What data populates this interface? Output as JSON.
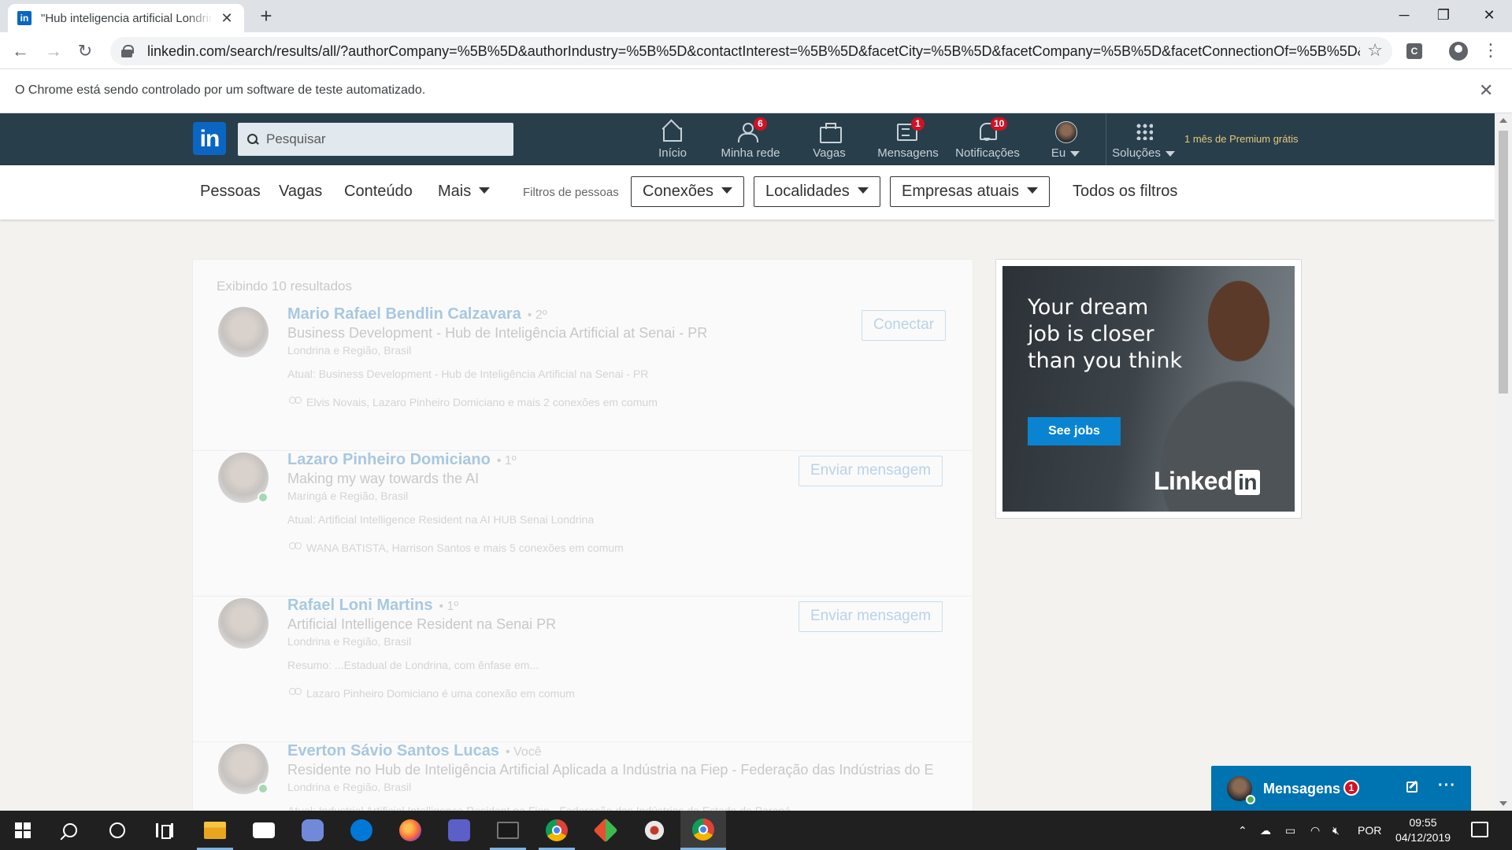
{
  "browser": {
    "tab_title": "\"Hub inteligencia artificial Londrina\"",
    "tab_favicon": "in",
    "url": "linkedin.com/search/results/all/?authorCompany=%5B%5D&authorIndustry=%5B%5D&contactInterest=%5B%5D&facetCity=%5B%5D&facetCompany=%5B%5D&facetConnectionOf=%5B%5D&fac...",
    "infobar_text": "O Chrome está sendo controlado por um software de teste automatizado.",
    "extension_label": "C"
  },
  "linkedin": {
    "logo": "in",
    "search_placeholder": "Pesquisar",
    "nav": {
      "home": "Início",
      "network": "Minha rede",
      "network_badge": "6",
      "jobs": "Vagas",
      "messages": "Mensagens",
      "messages_badge": "1",
      "notifications": "Notificações",
      "notifications_badge": "10",
      "me": "Eu",
      "solutions": "Soluções",
      "premium": "1 mês de Premium grátis"
    },
    "filters": {
      "tabs": [
        "Pessoas",
        "Vagas",
        "Conteúdo",
        "Mais"
      ],
      "people_filters_label": "Filtros de pessoas",
      "connections": "Conexões",
      "locations": "Localidades",
      "companies": "Empresas atuais",
      "all_filters": "Todos os filtros"
    },
    "results": {
      "count_text": "Exibindo 10 resultados",
      "items": [
        {
          "name": "Mario Rafael Bendlin Calzavara",
          "degree": "• 2º",
          "headline": "Business Development - Hub de Inteligência Artificial at Senai - PR",
          "location": "Londrina e Região, Brasil",
          "snippet": "Atual: Business Development - Hub de Inteligência Artificial na Senai - PR",
          "shared": "Elvis Novais, Lazaro Pinheiro Domiciano e mais 2 conexões em comum",
          "action": "Conectar"
        },
        {
          "name": "Lazaro Pinheiro Domiciano",
          "degree": "• 1º",
          "headline": "Making my way towards the AI",
          "location": "Maringá e Região, Brasil",
          "snippet": "Atual: Artificial Intelligence Resident na AI HUB Senai Londrina",
          "shared": "WANA BATISTA, Harrison Santos e mais 5 conexões em comum",
          "action": "Enviar mensagem"
        },
        {
          "name": "Rafael Loni Martins",
          "degree": "• 1º",
          "headline": "Artificial Intelligence Resident na Senai PR",
          "location": "Londrina e Região, Brasil",
          "snippet": "Resumo: ...Estadual de Londrina, com ênfase em...",
          "shared": "Lazaro Pinheiro Domiciano é uma conexão em comum",
          "action": "Enviar mensagem"
        },
        {
          "name": "Everton Sávio Santos Lucas",
          "degree": "• Você",
          "headline": "Residente no Hub de Inteligência Artificial Aplicada a Indústria na Fiep - Federação das Indústrias do Es...",
          "location": "Londrina e Região, Brasil",
          "snippet": "Atual: Industrial Artificial Intelligence Resident na Fiep - Federação das Indústrias do Estado do Paraná",
          "shared": "",
          "action": ""
        }
      ]
    },
    "ad": {
      "headline": "Your dream job is closer than you think",
      "cta": "See jobs",
      "logo_text": "Linked",
      "logo_in": "in"
    },
    "messaging": {
      "title": "Mensagens",
      "badge": "1"
    }
  },
  "taskbar": {
    "language": "POR",
    "time": "09:55",
    "date": "04/12/2019"
  }
}
